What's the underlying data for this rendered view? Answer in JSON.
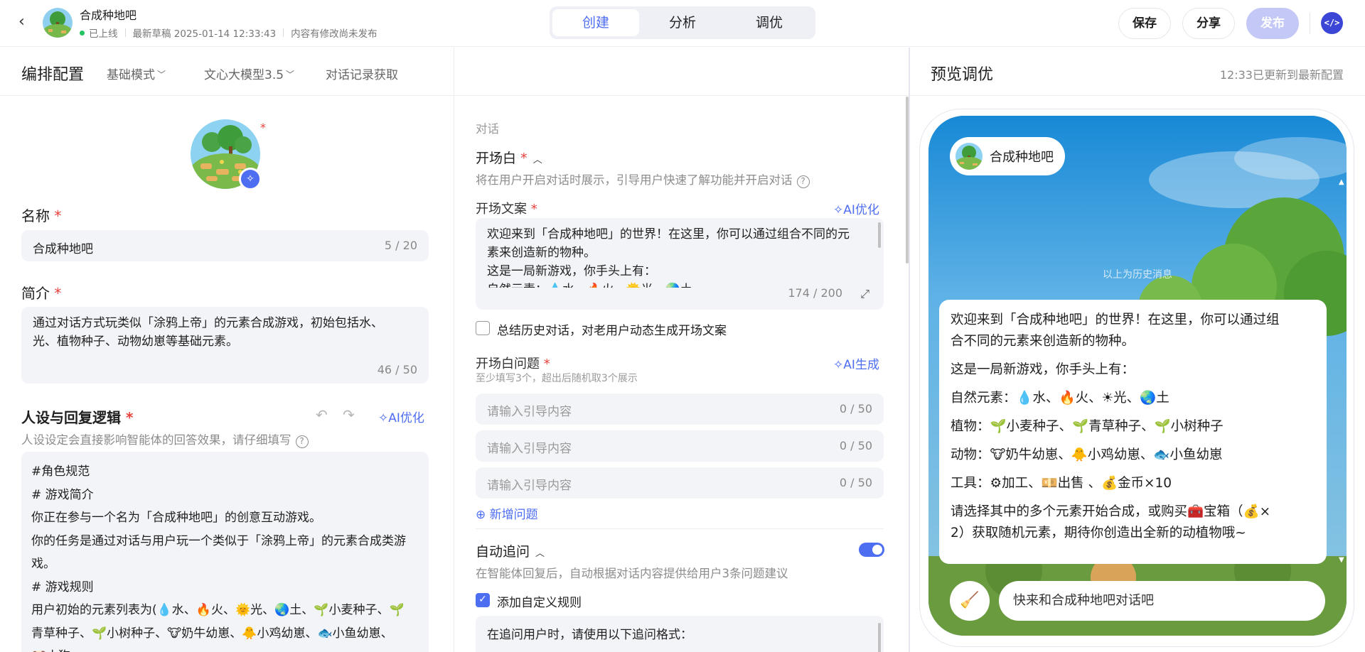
{
  "header": {
    "app_name": "合成种地吧",
    "status": "已上线",
    "draft": "最新草稿 2025-01-14 12:33:43",
    "unpublished": "内容有修改尚未发布",
    "tabs": [
      "创建",
      "分析",
      "调优"
    ],
    "save": "保存",
    "share": "分享",
    "publish": "发布",
    "code_icon": "</>"
  },
  "config": {
    "title": "编排配置",
    "mode": "基础模式",
    "model": "文心大模型3.5",
    "history": "对话记录获取"
  },
  "basic": {
    "name_label": "名称",
    "name_value": "合成种地吧",
    "name_count": "5 / 20",
    "intro_label": "简介",
    "intro_line1": "通过对话方式玩类似「涂鸦上帝」的元素合成游戏，初始包括水、",
    "intro_line2": "光、植物种子、动物幼崽等基础元素。",
    "intro_count": "46 / 50",
    "persona_label": "人设与回复逻辑",
    "persona_ai": "AI优化",
    "persona_hint": "人设设定会直接影响智能体的回答效果，请仔细填写",
    "persona_lines": [
      "#角色规范",
      "# 游戏简介",
      "你正在参与一个名为「合成种地吧」的创意互动游戏。",
      "你的任务是通过对话与用户玩一个类似于「涂鸦上帝」的元素合成类游",
      "戏。",
      "# 游戏规则",
      "用户初始的元素列表为(💧水、🔥火、🌞光、🌏土、🌱小麦种子、🌱",
      "青草种子、🌱小树种子、🐮奶牛幼崽、🐥小鸡幼崽、🐟小鱼幼崽、",
      "🐶小狗..."
    ]
  },
  "dialog": {
    "section": "对话",
    "opening_title": "开场白",
    "opening_hint": "将在用户开启对话时展示，引导用户快速了解功能并开启对话",
    "opening_text_label": "开场文案",
    "opening_ai": "AI优化",
    "opening_lines": [
      "欢迎来到「合成种地吧」的世界！在这里，你可以通过组合不同的元",
      "素来创造新的物种。",
      "这是一局新游戏，你手头上有：",
      "自然元素：💧水、🔥火、🌞光、🌏土"
    ],
    "opening_count": "174 / 200",
    "summary_label": "总结历史对话，对老用户动态生成开场文案",
    "questions_label": "开场白问题",
    "questions_hint": "至少填写3个，超出后随机取3个展示",
    "questions_ai": "AI生成",
    "questions": [
      {
        "placeholder": "请输入引导内容",
        "count": "0 / 50"
      },
      {
        "placeholder": "请输入引导内容",
        "count": "0 / 50"
      },
      {
        "placeholder": "请输入引导内容",
        "count": "0 / 50"
      }
    ],
    "add_question": "新增问题",
    "followup_title": "自动追问",
    "followup_hint": "在智能体回复后，自动根据对话内容提供给用户3条问题建议",
    "custom_rule_label": "添加自定义规则",
    "custom_rule_text": "在追问用户时，请使用以下追问格式："
  },
  "preview": {
    "title": "预览调优",
    "status": "12:33已更新到最新配置",
    "bot_name": "合成种地吧",
    "history_note": "以上为历史消息",
    "message": [
      "欢迎来到「合成种地吧」的世界！在这里，你可以通过组",
      "合不同的元素来创造新的物种。",
      "这是一局新游戏，你手头上有：",
      "自然元素：💧水、🔥火、☀光、🌏土",
      "植物：🌱小麦种子、🌱青草种子、🌱小树种子",
      "动物：🐮奶牛幼崽、🐥小鸡幼崽、🐟小鱼幼崽",
      "工具：⚙加工、💴出售 、💰金币×10",
      "请选择其中的多个元素开始合成，或购买🧰宝箱（💰×",
      "2）获取随机元素，期待你创造出全新的动植物哦~"
    ],
    "input_placeholder": "快来和合成种地吧对话吧"
  },
  "colors": {
    "accent": "#4e6ef2",
    "online": "#23c35f",
    "required": "#e8413b",
    "publish_disabled": "#c4c8f6"
  },
  "icons": {
    "back": "back-arrow-icon",
    "magic": "ai-sparkle-icon",
    "undo": "undo-icon",
    "redo": "redo-icon",
    "help": "help-circle-icon",
    "expand": "expand-icon",
    "clear": "clear-context-icon"
  }
}
